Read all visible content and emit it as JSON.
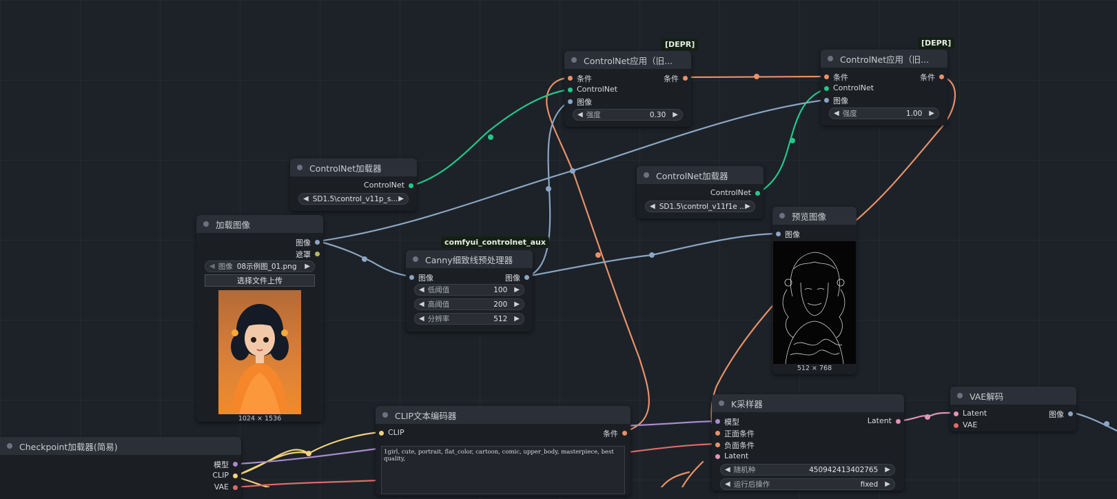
{
  "nodes": {
    "cn_apply_1": {
      "badge": "[DEPR]",
      "title": "ControlNet应用（旧...",
      "in_cond": "条件",
      "in_controlnet": "ControlNet",
      "in_image": "图像",
      "out_cond": "条件",
      "strength_label": "强度",
      "strength_value": "0.30"
    },
    "cn_apply_2": {
      "badge": "[DEPR]",
      "title": "ControlNet应用（旧...",
      "in_cond": "条件",
      "in_controlnet": "ControlNet",
      "in_image": "图像",
      "out_cond": "条件",
      "strength_label": "强度",
      "strength_value": "1.00"
    },
    "cn_loader_1": {
      "title": "ControlNet加载器",
      "out_controlnet": "ControlNet",
      "model_value": "SD1.5\\control_v11p_s..."
    },
    "cn_loader_2": {
      "title": "ControlNet加载器",
      "out_controlnet": "ControlNet",
      "model_value": "SD1.5\\control_v11f1e ..."
    },
    "load_image": {
      "title": "加载图像",
      "out_image": "图像",
      "out_mask": "遮罩",
      "image_label": "图像",
      "image_value": "08示例图_01.png",
      "upload_button": "选择文件上传",
      "preview_caption": "1024 × 1536"
    },
    "canny": {
      "badge": "comfyui_controlnet_aux",
      "title": "Canny细致线预处理器",
      "in_image": "图像",
      "out_image": "图像",
      "low_label": "低阈值",
      "low_value": "100",
      "high_label": "高阈值",
      "high_value": "200",
      "res_label": "分辨率",
      "res_value": "512"
    },
    "preview": {
      "title": "预览图像",
      "in_image": "图像",
      "caption": "512 × 768"
    },
    "ksampler": {
      "title": "K采样器",
      "in_model": "模型",
      "in_positive": "正面条件",
      "in_negative": "负面条件",
      "in_latent": "Latent",
      "out_latent": "Latent",
      "seed_label": "随机种",
      "seed_value": "450942413402765",
      "after_label": "运行后操作",
      "after_value": "fixed"
    },
    "vae_decode": {
      "title": "VAE解码",
      "in_latent": "Latent",
      "in_vae": "VAE",
      "out_image": "图像"
    },
    "clip_encode": {
      "title": "CLIP文本编码器",
      "in_clip": "CLIP",
      "out_cond": "条件",
      "text": "1girl, cute, portrait, flat_color, cartoon, comic,  upper_body, masterpiece, best quality,"
    },
    "checkpoint": {
      "title": "Checkpoint加载器(简易)",
      "out_model": "模型",
      "out_clip": "CLIP",
      "out_vae": "VAE"
    }
  },
  "colors": {
    "conditioning": "#e9916a",
    "controlnet": "#22c98a",
    "image": "#8aa6c4",
    "clip": "#f2d27a",
    "model": "#a88ad0",
    "latent": "#e494b6",
    "vae": "#e06a6a",
    "mask": "#b5b862"
  }
}
